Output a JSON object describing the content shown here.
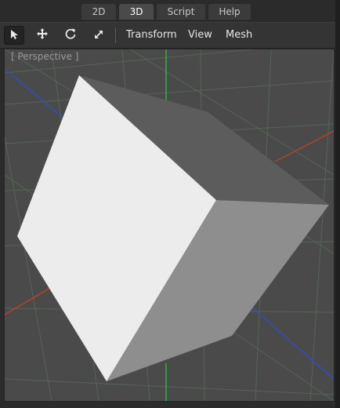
{
  "tabs": [
    {
      "label": "2D",
      "active": false
    },
    {
      "label": "3D",
      "active": true
    },
    {
      "label": "Script",
      "active": false
    },
    {
      "label": "Help",
      "active": false
    }
  ],
  "toolbar": {
    "tools": [
      {
        "icon": "select-arrow-icon",
        "active": true
      },
      {
        "icon": "move-icon",
        "active": false
      },
      {
        "icon": "rotate-icon",
        "active": false
      },
      {
        "icon": "scale-icon",
        "active": false
      }
    ],
    "menus": [
      "Transform",
      "View",
      "Mesh"
    ]
  },
  "viewport": {
    "label": "[ Perspective ]",
    "background": "#4a4a4a",
    "axis_colors": {
      "x": "#c0392b",
      "y": "#27ae60",
      "z": "#2e4fd6"
    }
  },
  "colors": {
    "tab_active": "#4a4a4a",
    "tab_inactive": "#3b3b3b",
    "toolbar_bg": "#343434"
  }
}
